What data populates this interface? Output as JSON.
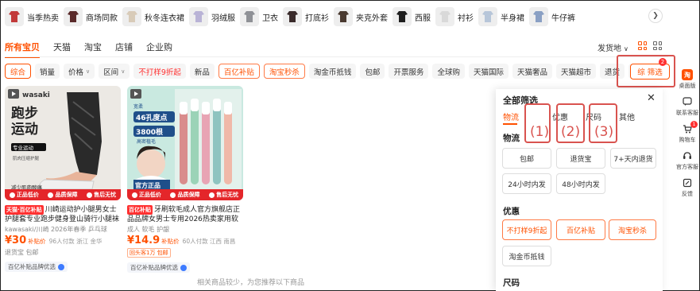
{
  "categories": [
    {
      "label": "当季热卖",
      "icon": "jacket-icon",
      "color": "#c23a3a"
    },
    {
      "label": "商场同款",
      "icon": "sweater-icon",
      "color": "#5a2a2a"
    },
    {
      "label": "秋冬连衣裙",
      "icon": "dress-icon",
      "color": "#d8cbb8"
    },
    {
      "label": "羽绒服",
      "icon": "down-jacket-icon",
      "color": "#b9b3d6"
    },
    {
      "label": "卫衣",
      "icon": "hoodie-icon",
      "color": "#8f9196"
    },
    {
      "label": "打底衫",
      "icon": "base-shirt-icon",
      "color": "#3a2b2b"
    },
    {
      "label": "夹克外套",
      "icon": "jacket-icon",
      "color": "#4a3a30"
    },
    {
      "label": "西服",
      "icon": "blazer-icon",
      "color": "#1e1e1e"
    },
    {
      "label": "衬衫",
      "icon": "shirt-icon",
      "color": "#d9d9d9"
    },
    {
      "label": "半身裙",
      "icon": "skirt-icon",
      "color": "#b7c6d9"
    },
    {
      "label": "牛仔裤",
      "icon": "jeans-icon",
      "color": "#8aa0c4"
    }
  ],
  "tabs": [
    {
      "label": "所有宝贝",
      "active": true
    },
    {
      "label": "天猫",
      "active": false
    },
    {
      "label": "淘宝",
      "active": false
    },
    {
      "label": "店铺",
      "active": false
    },
    {
      "label": "企业购",
      "active": false
    }
  ],
  "ship_from": "发货地",
  "chips": [
    {
      "label": "综合",
      "style": "sel"
    },
    {
      "label": "销量",
      "style": ""
    },
    {
      "label": "价格",
      "style": "",
      "caret": true
    },
    {
      "label": "区间",
      "style": "",
      "caret": true
    },
    {
      "label": "不打样9折起",
      "style": "red-txt"
    },
    {
      "label": "新品",
      "style": ""
    },
    {
      "label": "百亿补贴",
      "style": "red-out"
    },
    {
      "label": "淘宝秒杀",
      "style": "red-out"
    },
    {
      "label": "淘金币抵钱",
      "style": ""
    },
    {
      "label": "包邮",
      "style": ""
    },
    {
      "label": "开票服务",
      "style": ""
    },
    {
      "label": "全球购",
      "style": ""
    },
    {
      "label": "天猫国际",
      "style": ""
    },
    {
      "label": "天猫奢品",
      "style": ""
    },
    {
      "label": "天猫超市",
      "style": ""
    },
    {
      "label": "退货",
      "style": ""
    }
  ],
  "filter_button": {
    "label": "综 筛选",
    "badge": "2"
  },
  "products": [
    {
      "image_brand": "wasaki",
      "image_headline": "跑步运动",
      "image_sub": "专业运动",
      "image_note": "肌肉压缩护腿",
      "image_foot": "减少肌肉酸痛",
      "badges": [
        "正品低价",
        "品质保障",
        "售后无忧"
      ],
      "store_tag": "天猫·百亿补贴",
      "title": "川崎运动护小腿男女士护腿套专业跑步健身登山骑行小腿袜透...",
      "meta": "kawasaki/川崎    2026年春季    乒乓球",
      "price": "¥30",
      "price_tag": "补贴价",
      "sales": "96人付款  浙江 金华",
      "extra": "退货宝  包邮",
      "bybt": "百亿补贴品牌优选"
    },
    {
      "image_brand": "宽柔",
      "image_headline": "46孔度点",
      "image_sub": "3800根",
      "image_note": "高密植毛",
      "image_foot": "官方正品",
      "badges": [
        "正品低价",
        "品质保障",
        "售后无忧"
      ],
      "store_tag": "百亿补贴",
      "title": "牙刷软毛成人官方旗舰店正品品牌女男士专用2026热卖家用软毛牙刷",
      "meta": "成人    软毛    护龈",
      "price": "¥14.9",
      "price_tag": "补贴价",
      "sales": "60人付款  江西 南昌",
      "extra": "回头客1万  包邮",
      "bybt": "百亿补贴品牌优选"
    }
  ],
  "more_note": "相关商品较少，为您推荐以下商品",
  "panel": {
    "title": "全部筛选",
    "tabs": [
      "物流",
      "优惠",
      "尺码",
      "其他"
    ],
    "section_logistics": "物流",
    "logistics_opts": [
      "包邮",
      "退货宝",
      "7+天内退货",
      "24小时内发",
      "48小时内发"
    ],
    "section_offers": "优惠",
    "offer_opts": [
      "不打样9折起",
      "百亿补贴",
      "淘宝秒杀",
      "淘金币抵钱"
    ],
    "section_size": "尺码"
  },
  "annotations": [
    "(1)",
    "(2)",
    "(3)"
  ],
  "sidebar": [
    {
      "label": "桌面版",
      "icon": "taobao-logo-icon"
    },
    {
      "label": "联系客服",
      "icon": "chat-icon"
    },
    {
      "label": "购物车",
      "icon": "cart-icon",
      "badge": "1"
    },
    {
      "label": "官方客服",
      "icon": "headset-icon"
    },
    {
      "label": "反馈",
      "icon": "feedback-icon"
    }
  ],
  "accent": "#ff5000",
  "annotation_color": "#d9534f"
}
